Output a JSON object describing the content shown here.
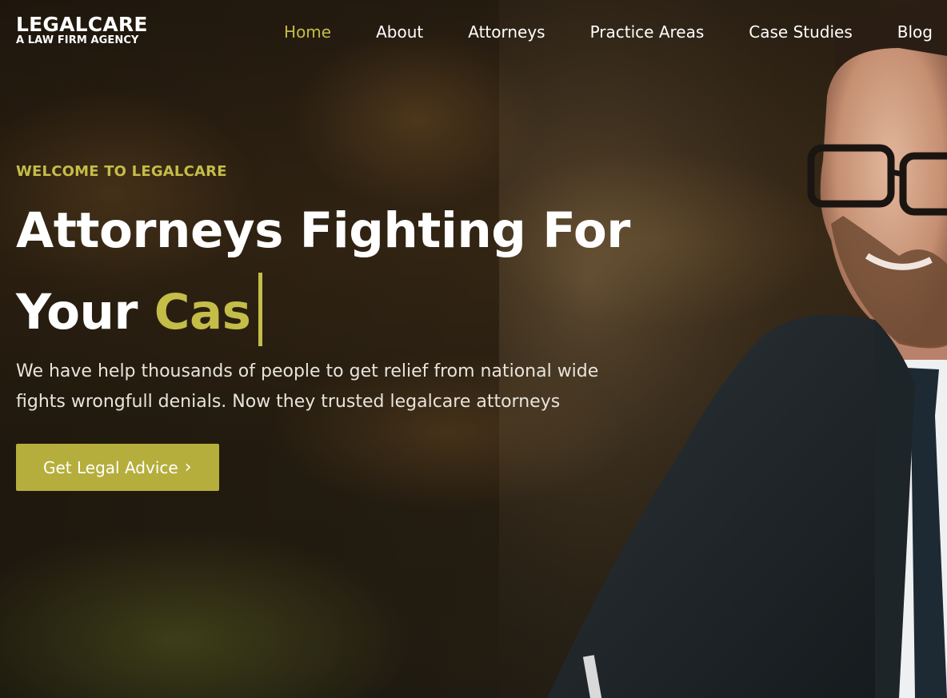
{
  "brand": {
    "name": "LEGALCARE",
    "tagline": "A LAW FIRM AGENCY"
  },
  "nav": {
    "items": [
      {
        "label": "Home",
        "active": true
      },
      {
        "label": "About",
        "active": false
      },
      {
        "label": "Attorneys",
        "active": false
      },
      {
        "label": "Practice Areas",
        "active": false
      },
      {
        "label": "Case Studies",
        "active": false
      },
      {
        "label": "Blog",
        "active": false
      }
    ]
  },
  "hero": {
    "eyebrow": "WELCOME TO LEGALCARE",
    "headline_line1": "Attorneys Fighting For",
    "headline_line2_plain": "Your ",
    "headline_line2_accent": "Cas",
    "description": "We have help thousands of people to get relief from national wide fights wrongfull denials. Now they trusted legalcare attorneys",
    "cta_label": "Get Legal Advice",
    "cta_icon": "chevron-right-icon"
  },
  "colors": {
    "accent": "#c4bd48",
    "button": "#b5ae3c",
    "text": "#ffffff"
  }
}
